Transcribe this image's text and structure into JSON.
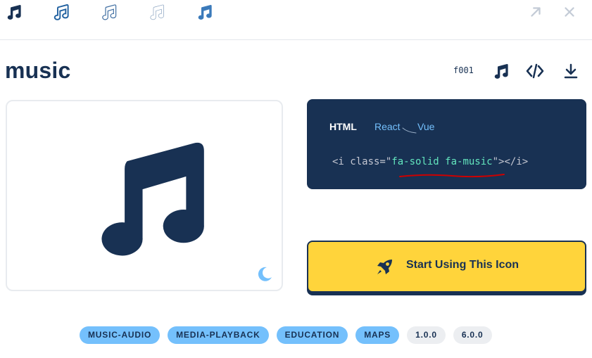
{
  "variants": [
    "solid",
    "regular",
    "light",
    "thin",
    "duotone"
  ],
  "top_actions": {
    "open": "arrow-up-right-icon",
    "close": "close-icon"
  },
  "icon": {
    "name": "music",
    "unicode": "f001"
  },
  "header_actions": {
    "glyph": "music-icon",
    "code": "code-icon",
    "download": "download-icon"
  },
  "code_panel": {
    "tabs": [
      "HTML",
      "React",
      "Vue"
    ],
    "code": {
      "open": "<i class=\"",
      "value": "fa-solid fa-music",
      "close": "\"></i>"
    }
  },
  "cta": {
    "label": "Start Using This Icon",
    "icon": "rocket-icon"
  },
  "categories": [
    "MUSIC-AUDIO",
    "MEDIA-PLAYBACK",
    "EDUCATION",
    "MAPS"
  ],
  "versions": [
    "1.0.0",
    "6.0.0"
  ],
  "colors": {
    "navy": "#183153",
    "yellow": "#ffd43b",
    "light_blue": "#74c0fc",
    "mint": "#63e6be",
    "annotation_red": "#cc0000"
  }
}
